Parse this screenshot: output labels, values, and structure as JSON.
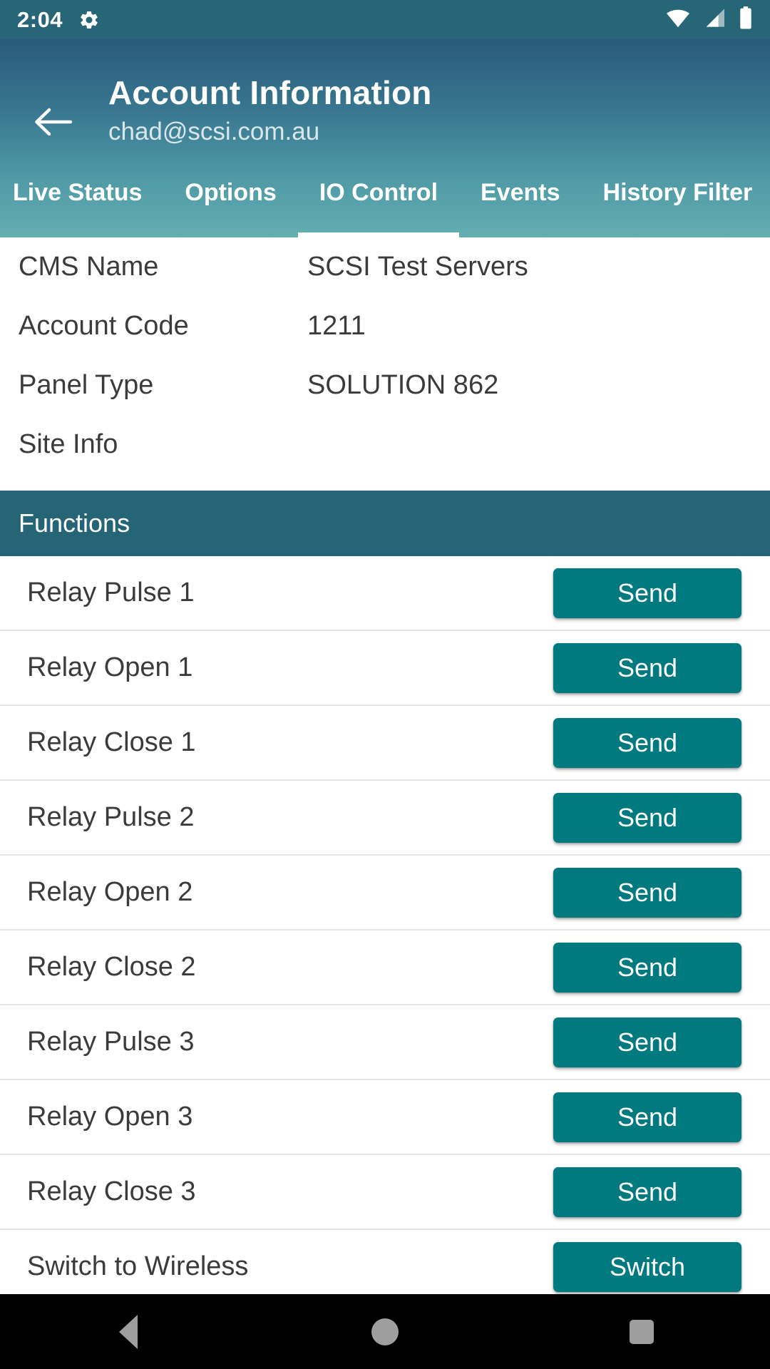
{
  "status_bar": {
    "clock": "2:04",
    "gear_icon": "gear-icon",
    "wifi_icon": "wifi-icon",
    "signal_icon": "cellular-signal-icon",
    "battery_icon": "battery-icon"
  },
  "header": {
    "back_icon": "back-arrow-icon",
    "title": "Account Information",
    "subtitle": "chad@scsi.com.au",
    "gradient_top": "#2a5a7b",
    "gradient_bottom": "#63aeb1"
  },
  "tabs": {
    "active_index": 2,
    "items": [
      {
        "label": "Live Status"
      },
      {
        "label": "Options"
      },
      {
        "label": "IO Control"
      },
      {
        "label": "Events"
      },
      {
        "label": "History Filter"
      }
    ]
  },
  "info": {
    "rows": [
      {
        "label": "CMS Name",
        "value": "SCSI Test Servers"
      },
      {
        "label": "Account Code",
        "value": "1211"
      },
      {
        "label": "Panel Type",
        "value": "SOLUTION 862"
      },
      {
        "label": "Site Info",
        "value": ""
      }
    ]
  },
  "functions_section": {
    "header": "Functions",
    "header_color": "#266575",
    "button_color": "#00797f",
    "rows": [
      {
        "label": "Relay Pulse 1",
        "action": "Send"
      },
      {
        "label": "Relay Open 1",
        "action": "Send"
      },
      {
        "label": "Relay Close 1",
        "action": "Send"
      },
      {
        "label": "Relay Pulse 2",
        "action": "Send"
      },
      {
        "label": "Relay Open 2",
        "action": "Send"
      },
      {
        "label": "Relay Close 2",
        "action": "Send"
      },
      {
        "label": "Relay Pulse 3",
        "action": "Send"
      },
      {
        "label": "Relay Open 3",
        "action": "Send"
      },
      {
        "label": "Relay Close 3",
        "action": "Send"
      },
      {
        "label": "Switch to Wireless",
        "action": "Switch"
      }
    ]
  },
  "nav_bar": {
    "back_icon": "nav-back-icon",
    "home_icon": "nav-home-icon",
    "recents_icon": "nav-recents-icon"
  }
}
